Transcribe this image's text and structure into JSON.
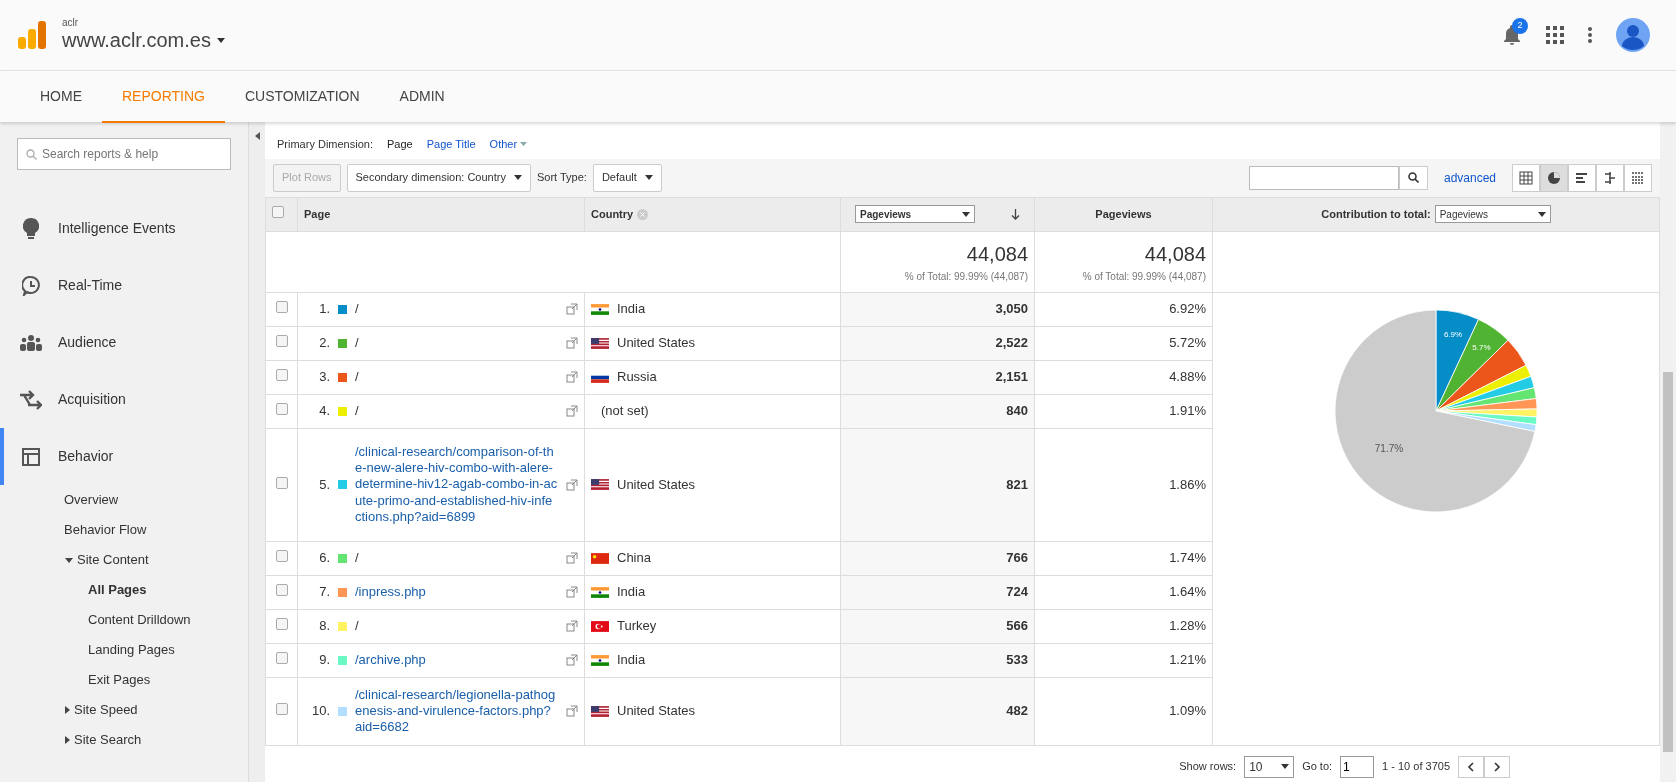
{
  "header": {
    "account": "aclr",
    "property": "www.aclr.com.es",
    "notifications": "2"
  },
  "tabs": [
    {
      "label": "HOME",
      "selected": false
    },
    {
      "label": "REPORTING",
      "selected": true
    },
    {
      "label": "CUSTOMIZATION",
      "selected": false
    },
    {
      "label": "ADMIN",
      "selected": false
    }
  ],
  "sidebar": {
    "search": {
      "placeholder": "Search reports & help"
    },
    "items": [
      {
        "label": "Intelligence Events",
        "selected": false
      },
      {
        "label": "Real-Time",
        "selected": false
      },
      {
        "label": "Audience",
        "selected": false
      },
      {
        "label": "Acquisition",
        "selected": false
      },
      {
        "label": "Behavior",
        "selected": true,
        "children": [
          {
            "label": "Overview",
            "selected": false
          },
          {
            "label": "Behavior Flow",
            "selected": false
          },
          {
            "label": "Site Content",
            "selected": false,
            "expanded": true,
            "children": [
              {
                "label": "All Pages",
                "selected": true
              },
              {
                "label": "Content Drilldown",
                "selected": false
              },
              {
                "label": "Landing Pages",
                "selected": false
              },
              {
                "label": "Exit Pages",
                "selected": false
              }
            ]
          },
          {
            "label": "Site Speed",
            "selected": false,
            "expanded": false
          },
          {
            "label": "Site Search",
            "selected": false,
            "expanded": false
          }
        ]
      }
    ]
  },
  "primary_dimension": {
    "label": "Primary Dimension:",
    "options": [
      {
        "label": "Page",
        "selected": true,
        "kind": "plain"
      },
      {
        "label": "Page Title",
        "selected": false,
        "kind": "plain"
      },
      {
        "label": "Other",
        "selected": false,
        "kind": "menu"
      }
    ]
  },
  "toolbar": {
    "plot_rows": {
      "label": "Plot Rows",
      "disabled": true
    },
    "secondary_dimension": "Secondary dimension: Country",
    "sort_label": "Sort Type:",
    "sort_value": "Default",
    "advanced": "advanced",
    "views": [
      {
        "selected": false
      },
      {
        "selected": true
      },
      {
        "selected": false
      },
      {
        "selected": false
      },
      {
        "selected": false
      }
    ]
  },
  "table": {
    "select_all": {
      "checked": false
    },
    "columns": {
      "page": "Page",
      "country": "Country",
      "metric_select": "Pageviews",
      "metric": "Pageviews",
      "contribution_label": "Contribution to total:",
      "contribution_select": "Pageviews"
    },
    "totals": [
      {
        "value": "44,084",
        "note": "% of Total: 99.99% (44,087)"
      },
      {
        "value": "44,084",
        "note": "% of Total: 99.99% (44,087)"
      }
    ],
    "rows": [
      {
        "index": "1.",
        "color": "#058dc7",
        "page": "/",
        "country": "India",
        "pageviews": "3,050",
        "percent": "6.92%",
        "checked": false
      },
      {
        "index": "2.",
        "color": "#50b432",
        "page": "/",
        "country": "United States",
        "pageviews": "2,522",
        "percent": "5.72%",
        "checked": false
      },
      {
        "index": "3.",
        "color": "#ed561b",
        "page": "/",
        "country": "Russia",
        "pageviews": "2,151",
        "percent": "4.88%",
        "checked": false
      },
      {
        "index": "4.",
        "color": "#edef00",
        "page": "/",
        "country": "(not set)",
        "pageviews": "840",
        "percent": "1.91%",
        "checked": false
      },
      {
        "index": "5.",
        "color": "#24cbe5",
        "page": "/clinical-research/comparison-of-the-new-alere-hiv-combo-with-alere-determine-hiv12-agab-combo-in-acute-primo-and-established-hiv-infections.php?aid=6899",
        "country": "United States",
        "pageviews": "821",
        "percent": "1.86%",
        "checked": false
      },
      {
        "index": "6.",
        "color": "#64e572",
        "page": "/",
        "country": "China",
        "pageviews": "766",
        "percent": "1.74%",
        "checked": false
      },
      {
        "index": "7.",
        "color": "#ff9655",
        "page": "/inpress.php",
        "country": "India",
        "pageviews": "724",
        "percent": "1.64%",
        "checked": false
      },
      {
        "index": "8.",
        "color": "#fff263",
        "page": "/",
        "country": "Turkey",
        "pageviews": "566",
        "percent": "1.28%",
        "checked": false
      },
      {
        "index": "9.",
        "color": "#6af9c4",
        "page": "/archive.php",
        "country": "India",
        "pageviews": "533",
        "percent": "1.21%",
        "checked": false
      },
      {
        "index": "10.",
        "color": "#b2deff",
        "page": "/clinical-research/legionella-pathogenesis-and-virulence-factors.php?aid=6682",
        "country": "United States",
        "pageviews": "482",
        "percent": "1.09%",
        "checked": false
      }
    ],
    "chart_data": {
      "type": "pie",
      "values": [
        6.92,
        5.72,
        4.88,
        1.91,
        1.86,
        1.74,
        1.64,
        1.28,
        1.21,
        1.09,
        71.75
      ],
      "colors": [
        "#058dc7",
        "#50b432",
        "#ed561b",
        "#edef00",
        "#24cbe5",
        "#64e572",
        "#ff9655",
        "#fff263",
        "#6af9c4",
        "#b2deff",
        "#cccccc"
      ],
      "value_labels": [
        "6.9%",
        "5.7%",
        null,
        null,
        null,
        null,
        null,
        null,
        null,
        null,
        "71.7%"
      ]
    }
  },
  "pagination": {
    "show_rows_label": "Show rows:",
    "show_rows": "10",
    "goto_label": "Go to:",
    "goto": "1",
    "range": "1 - 10 of 3705"
  }
}
